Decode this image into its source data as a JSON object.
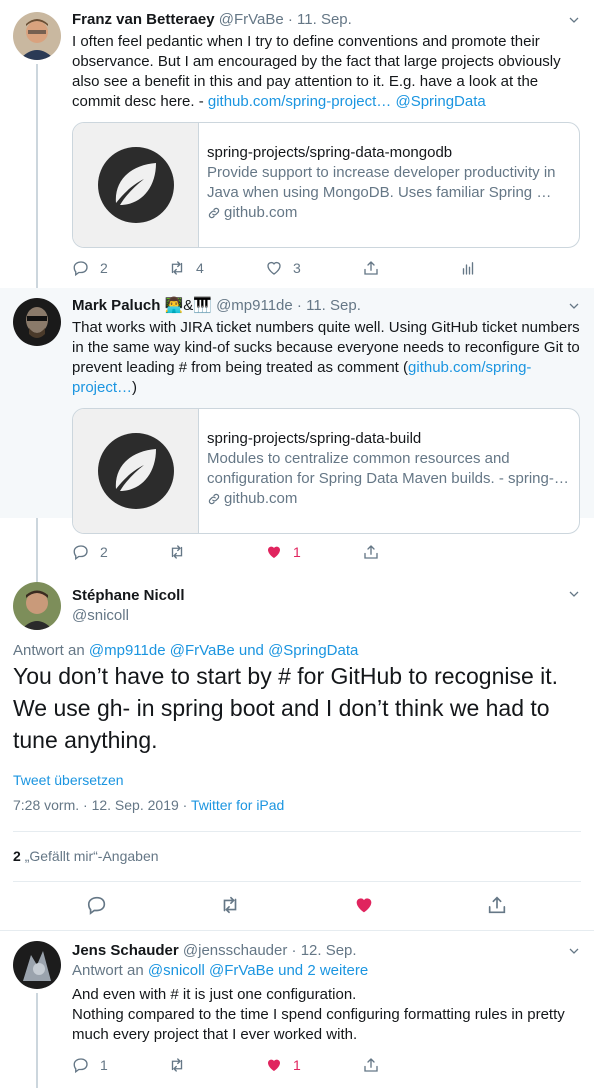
{
  "tweets": [
    {
      "name": "Franz van Betteraey",
      "handle": "@FrVaBe",
      "sep": "·",
      "date": "11. Sep.",
      "text_before": "I often feel pedantic when I try to define conventions and promote their observance. But I am encouraged by the fact that large projects obviously also see a benefit in this and pay attention to it. E.g. have a look at the commit desc here. - ",
      "link1": "github.com/spring-project…",
      "link2": "@SpringData",
      "card": {
        "title": "spring-projects/spring-data-mongodb",
        "desc": "Provide support to increase developer productivity in Java when using MongoDB. Uses familiar Spring …",
        "domain": "github.com"
      },
      "replies": "2",
      "retweets": "4",
      "likes": "3"
    },
    {
      "name": "Mark Paluch",
      "emoji": "👨‍💻&🎹",
      "handle": "@mp911de",
      "sep": "·",
      "date": "11. Sep.",
      "text_before": "That works with JIRA ticket numbers quite well. Using GitHub ticket numbers in the same way kind-of sucks because everyone needs to reconfigure Git to prevent leading # from being treated as comment (",
      "link1": "github.com/spring-project…",
      "text_after": ")",
      "card": {
        "title": "spring-projects/spring-data-build",
        "desc": "Modules to centralize common resources and configuration for Spring Data Maven builds. - spring-…",
        "domain": "github.com"
      },
      "replies": "2",
      "retweets": "",
      "likes": "1"
    }
  ],
  "main": {
    "name": "Stéphane Nicoll",
    "handle": "@snicoll",
    "reply_prefix": "Antwort an",
    "reply_to1": "@mp911de",
    "reply_to2": "@FrVaBe",
    "reply_and": "und",
    "reply_to3": "@SpringData",
    "text": "You don’t have to start by # for GitHub to recognise it. We use gh- in spring boot and I don’t think we had to tune anything.",
    "translate": "Tweet übersetzen",
    "time": "7:28 vorm. · 12. Sep. 2019",
    "sep": "·",
    "source": "Twitter for iPad",
    "likes_count": "2",
    "likes_label": "„Gefällt mir“-Angaben"
  },
  "reply": {
    "name": "Jens Schauder",
    "handle": "@jensschauder",
    "sep": "·",
    "date": "12. Sep.",
    "reply_prefix": "Antwort an",
    "reply_to1": "@snicoll",
    "reply_to2": "@FrVaBe",
    "reply_and": "und",
    "reply_more": "2 weitere",
    "text": "And even with # it is just one configuration.\nNothing compared to the time I spend configuring formatting rules in pretty much every  project that I ever worked with.",
    "replies": "1",
    "retweets": "",
    "likes": "1"
  },
  "colors": {
    "accent": "#1b95e0",
    "like": "#e0245e",
    "highlight": "#f5f8fa"
  },
  "icons": [
    "chevron-down-icon",
    "spring-leaf-icon",
    "link-icon",
    "reply-icon",
    "retweet-icon",
    "like-icon",
    "share-icon",
    "analytics-icon"
  ]
}
